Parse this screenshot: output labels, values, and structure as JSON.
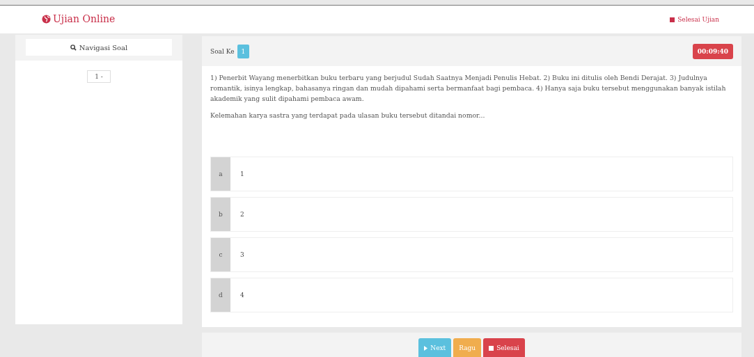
{
  "header": {
    "title": "Ujian Online",
    "finish_link": "Selesai Ujian"
  },
  "sidebar": {
    "title": "Navigasi Soal",
    "items": [
      {
        "label": "1 -"
      }
    ]
  },
  "question": {
    "label": "Soal Ke",
    "number": "1",
    "timer": "00:09:40",
    "text": "1) Penerbit Wayang menerbitkan buku terbaru yang berjudul Sudah Saatnya Menjadi Penulis Hebat. 2) Buku ini ditulis oleh Bendi Derajat. 3) Judulnya romantik, isinya lengkap, bahasanya ringan dan mudah dipahami serta bermanfaat bagi pembaca. 4) Hanya saja buku tersebut menggunakan banyak istilah akademik yang sulit dipahami pembaca awam.",
    "prompt": "Kelemahan karya sastra yang terdapat pada ulasan buku tersebut ditandai nomor...",
    "options": [
      {
        "letter": "a",
        "text": "1",
        "selected": false
      },
      {
        "letter": "b",
        "text": "2",
        "selected": false
      },
      {
        "letter": "c",
        "text": "3",
        "selected": false
      },
      {
        "letter": "d",
        "text": "4",
        "selected": false
      }
    ]
  },
  "footer": {
    "buttons": [
      {
        "kind": "next",
        "label": "Next"
      },
      {
        "kind": "doubt",
        "label": "Ragu"
      },
      {
        "kind": "finish",
        "label": "Selesai"
      }
    ]
  }
}
